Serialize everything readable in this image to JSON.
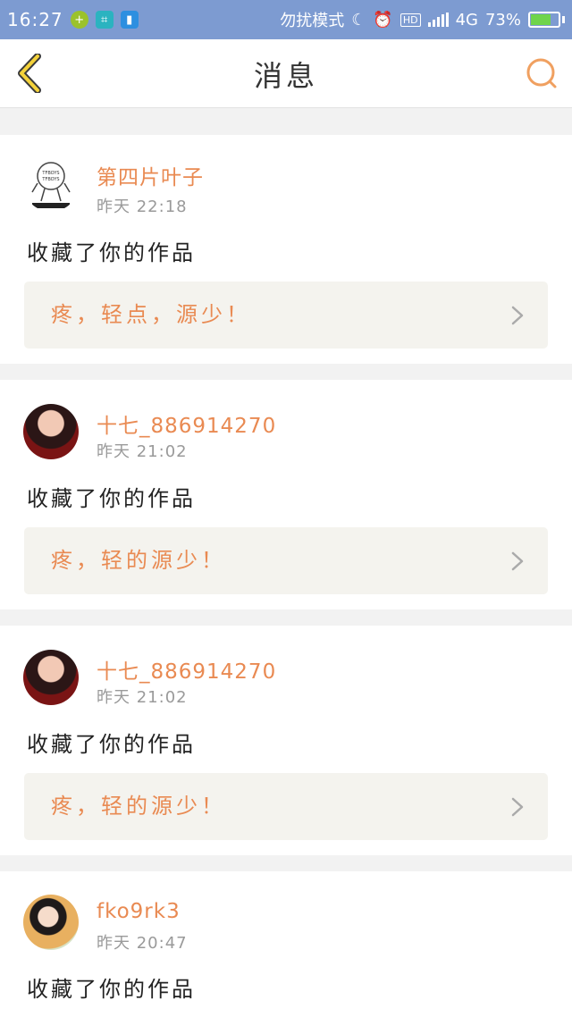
{
  "status_bar": {
    "time": "16:27",
    "dnd_label": "勿扰模式",
    "network": "4G",
    "battery_percent": "73%",
    "battery_level": 0.73,
    "colors": {
      "bar": "#7d9bd1",
      "battery": "#6fd44c"
    }
  },
  "header": {
    "title": "消息",
    "back_icon": "chevron-left-icon",
    "search_icon": "search-icon",
    "accent": "#e98a52"
  },
  "notifications": [
    {
      "username": "第四片叶子",
      "time": "昨天 22:18",
      "action": "收藏了你的作品",
      "quote": "疼，轻点，源少！",
      "avatar": "tfboys-sketch-avatar"
    },
    {
      "username": "十七_886914270",
      "time": "昨天 21:02",
      "action": "收藏了你的作品",
      "quote": "疼，轻的源少！",
      "avatar": "portrait-avatar"
    },
    {
      "username": "十七_886914270",
      "time": "昨天 21:02",
      "action": "收藏了你的作品",
      "quote": "疼，轻的源少！",
      "avatar": "portrait-avatar"
    },
    {
      "username": "fko9rk3",
      "time": "昨天 20:47",
      "action": "收藏了你的作品",
      "avatar": "costume-portrait-avatar"
    }
  ]
}
